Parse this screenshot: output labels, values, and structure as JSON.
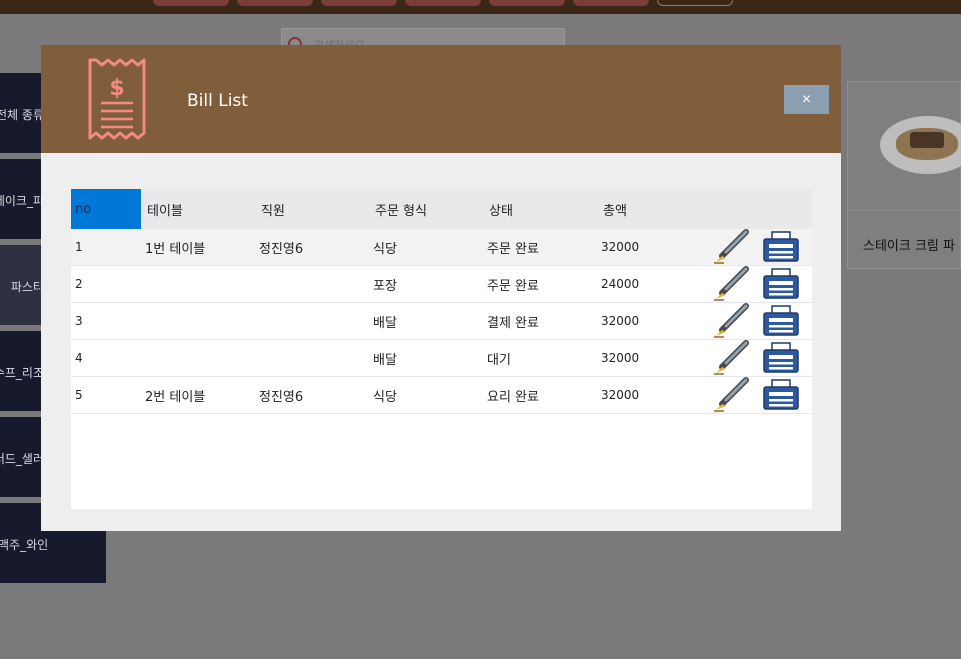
{
  "background": {
    "search_placeholder": "검색하세요",
    "categories": [
      {
        "label": "전체 종류"
      },
      {
        "label": "스테이크_파"
      },
      {
        "label": "파스타"
      },
      {
        "label": "수프_리조"
      },
      {
        "label": "샐러드_샐러"
      },
      {
        "label": "맥주_와인"
      }
    ],
    "menu_card": {
      "label": "스테이크 크림 파"
    }
  },
  "modal": {
    "title": "Bill List",
    "close_label": "×",
    "icon": "receipt-dollar-icon",
    "columns": [
      "no",
      "테이블",
      "직원",
      "주문 형식",
      "상태",
      "총액"
    ],
    "rows": [
      {
        "no": "1",
        "table": "1번 테이블",
        "staff": "정진영6",
        "order_type": "식당",
        "status": "주문 완료",
        "total": "32000"
      },
      {
        "no": "2",
        "table": "",
        "staff": "",
        "order_type": "포장",
        "status": "주문 완료",
        "total": "24000"
      },
      {
        "no": "3",
        "table": "",
        "staff": "",
        "order_type": "배달",
        "status": "결제 완료",
        "total": "32000"
      },
      {
        "no": "4",
        "table": "",
        "staff": "",
        "order_type": "배달",
        "status": "대기",
        "total": "32000"
      },
      {
        "no": "5",
        "table": "2번 테이블",
        "staff": "정진영6",
        "order_type": "식당",
        "status": "요리 완료",
        "total": "32000"
      }
    ],
    "row_actions": [
      "edit-pen-icon",
      "printer-icon"
    ]
  },
  "colors": {
    "header_bg": "#805e3c",
    "sorted_column": "#0078d7",
    "close_button": "#8aa0b1",
    "receipt_icon": "#f28b82"
  }
}
